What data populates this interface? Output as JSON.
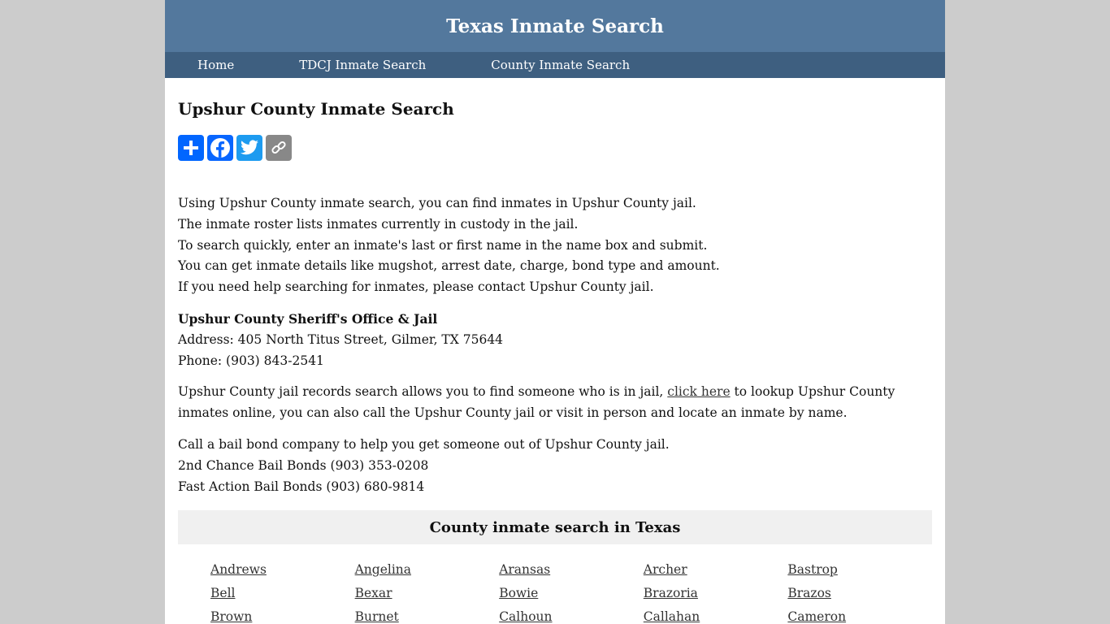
{
  "site": {
    "title": "Texas Inmate Search"
  },
  "nav": [
    "Home",
    "TDCJ Inmate Search",
    "County Inmate Search"
  ],
  "page_title": "Upshur County Inmate Search",
  "share": [
    "share-add-icon",
    "facebook-icon",
    "twitter-icon",
    "copy-link-icon"
  ],
  "intro": [
    "Using Upshur County inmate search, you can find inmates in Upshur County jail.",
    "The inmate roster lists inmates currently in custody in the jail.",
    "To search quickly, enter an inmate's last or first name in the name box and submit.",
    "You can get inmate details like mugshot, arrest date, charge, bond type and amount.",
    "If you need help searching for inmates, please contact Upshur County jail."
  ],
  "office": {
    "name": "Upshur County Sheriff's Office & Jail",
    "address": "Address: 405 North Titus Street, Gilmer, TX 75644",
    "phone": "Phone: (903) 843-2541"
  },
  "records": {
    "before": "Upshur County jail records search allows you to find someone who is in jail, ",
    "link": "click here",
    "after": " to lookup Upshur County inmates online, you can also call the Upshur County jail or visit in person and locate an inmate by name."
  },
  "bail": [
    "Call a bail bond company to help you get someone out of Upshur County jail.",
    "2nd Chance Bail Bonds (903) 353-0208",
    "Fast Action Bail Bonds (903) 680-9814"
  ],
  "county_section": {
    "heading": "County inmate search in Texas",
    "counties": [
      "Andrews",
      "Angelina",
      "Aransas",
      "Archer",
      "Bastrop",
      "Bell",
      "Bexar",
      "Bowie",
      "Brazoria",
      "Brazos",
      "Brown",
      "Burnet",
      "Calhoun",
      "Callahan",
      "Cameron"
    ]
  }
}
